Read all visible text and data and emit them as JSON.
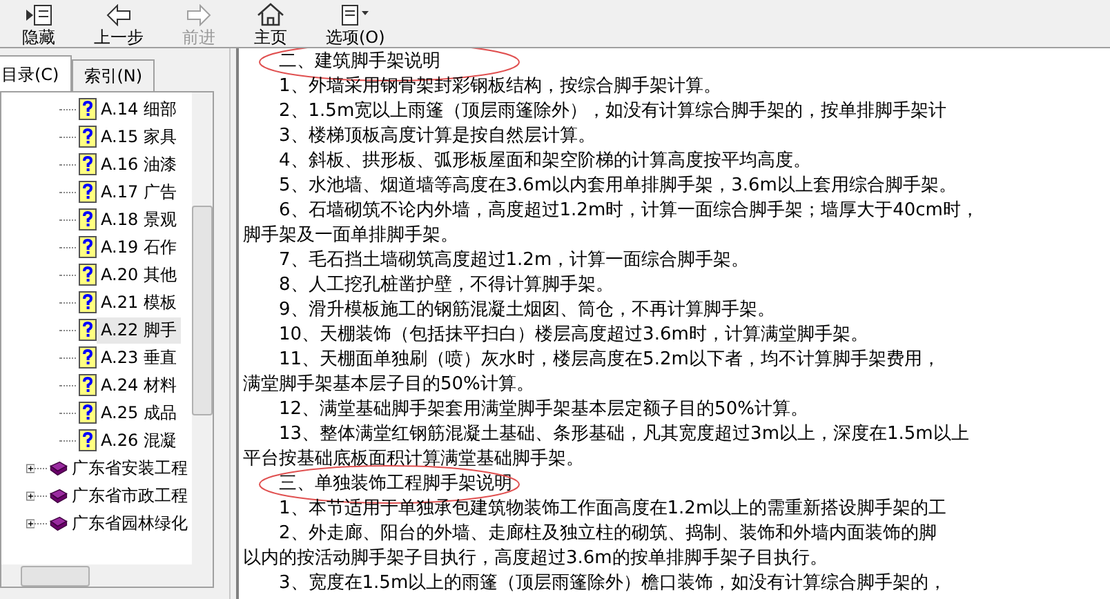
{
  "toolbar": [
    {
      "kind": "hide",
      "label": "隐藏",
      "disabled": false
    },
    {
      "kind": "back",
      "label": "上一步",
      "disabled": false
    },
    {
      "kind": "forward",
      "label": "前进",
      "disabled": true
    },
    {
      "kind": "home",
      "label": "主页",
      "disabled": false
    },
    {
      "kind": "options",
      "label": "选项(O)",
      "disabled": false
    }
  ],
  "tabs": [
    {
      "label": "目录(C)",
      "selected": true
    },
    {
      "label": "索引(N)",
      "selected": false
    }
  ],
  "tree": [
    {
      "kind": "page",
      "label": "A.14 细部",
      "selected": false
    },
    {
      "kind": "page",
      "label": "A.15 家具",
      "selected": false
    },
    {
      "kind": "page",
      "label": "A.16 油漆",
      "selected": false
    },
    {
      "kind": "page",
      "label": "A.17 广告",
      "selected": false
    },
    {
      "kind": "page",
      "label": "A.18 景观",
      "selected": false
    },
    {
      "kind": "page",
      "label": "A.19 石作",
      "selected": false
    },
    {
      "kind": "page",
      "label": "A.20 其他",
      "selected": false
    },
    {
      "kind": "page",
      "label": "A.21 模板",
      "selected": false
    },
    {
      "kind": "page",
      "label": "A.22 脚手",
      "selected": true
    },
    {
      "kind": "page",
      "label": "A.23 垂直",
      "selected": false
    },
    {
      "kind": "page",
      "label": "A.24 材料",
      "selected": false
    },
    {
      "kind": "page",
      "label": "A.25 成品",
      "selected": false
    },
    {
      "kind": "page",
      "label": "A.26 混凝",
      "selected": false
    },
    {
      "kind": "book",
      "label": "广东省安装工程",
      "selected": false,
      "expanded": false
    },
    {
      "kind": "book",
      "label": "广东省市政工程",
      "selected": false,
      "expanded": false
    },
    {
      "kind": "book",
      "label": "广东省园林绿化",
      "selected": false,
      "expanded": false
    }
  ],
  "content": [
    {
      "kind": "heading",
      "text": "二、建筑脚手架说明",
      "circled": true
    },
    {
      "kind": "item",
      "text": "1、外墙采用钢骨架封彩钢板结构，按综合脚手架计算。",
      "circled": false
    },
    {
      "kind": "item",
      "text": "2、1.5m宽以上雨篷（顶层雨篷除外），如没有计算综合脚手架的，按单排脚手架计",
      "circled": false
    },
    {
      "kind": "item",
      "text": "3、楼梯顶板高度计算是按自然层计算。",
      "circled": false
    },
    {
      "kind": "item",
      "text": "4、斜板、拱形板、弧形板屋面和架空阶梯的计算高度按平均高度。",
      "circled": false
    },
    {
      "kind": "item",
      "text": "5、水池墙、烟道墙等高度在3.6m以内套用单排脚手架，3.6m以上套用综合脚手架。",
      "circled": false
    },
    {
      "kind": "item",
      "text": "6、石墙砌筑不论内外墙，高度超过1.2m时，计算一面综合脚手架；墙厚大于40cm时，",
      "circled": false
    },
    {
      "kind": "continuation",
      "text": "脚手架及一面单排脚手架。",
      "circled": false
    },
    {
      "kind": "item",
      "text": "7、毛石挡土墙砌筑高度超过1.2m，计算一面综合脚手架。",
      "circled": false
    },
    {
      "kind": "item",
      "text": "8、人工挖孔桩凿护壁，不得计算脚手架。",
      "circled": false
    },
    {
      "kind": "item",
      "text": "9、滑升模板施工的钢筋混凝土烟囱、筒仓，不再计算脚手架。",
      "circled": false
    },
    {
      "kind": "item",
      "text": "10、天棚装饰（包括抹平扫白）楼层高度超过3.6m时，计算满堂脚手架。",
      "circled": false
    },
    {
      "kind": "item",
      "text": "11、天棚面单独刷（喷）灰水时，楼层高度在5.2m以下者，均不计算脚手架费用，",
      "circled": false
    },
    {
      "kind": "continuation",
      "text": "满堂脚手架基本层子目的50%计算。",
      "circled": false
    },
    {
      "kind": "item",
      "text": "12、满堂基础脚手架套用满堂脚手架基本层定额子目的50%计算。",
      "circled": false
    },
    {
      "kind": "item",
      "text": "13、整体满堂红钢筋混凝土基础、条形基础，凡其宽度超过3m以上，深度在1.5m以上",
      "circled": false
    },
    {
      "kind": "continuation",
      "text": "平台按基础底板面积计算满堂基础脚手架。",
      "circled": false
    },
    {
      "kind": "heading",
      "text": "三、单独装饰工程脚手架说明",
      "circled": true
    },
    {
      "kind": "item",
      "text": "1、本节适用于单独承包建筑物装饰工作面高度在1.2m以上的需重新搭设脚手架的工",
      "circled": false
    },
    {
      "kind": "item",
      "text": "2、外走廊、阳台的外墙、走廊柱及独立柱的砌筑、捣制、装饰和外墙内面装饰的脚",
      "circled": false
    },
    {
      "kind": "continuation",
      "text": "以内的按活动脚手架子目执行，高度超过3.6m的按单排脚手架子目执行。",
      "circled": false
    },
    {
      "kind": "item",
      "text": "3、宽度在1.5m以上的雨篷（顶层雨篷除外）檐口装饰，如没有计算综合脚手架的，",
      "circled": false
    }
  ]
}
